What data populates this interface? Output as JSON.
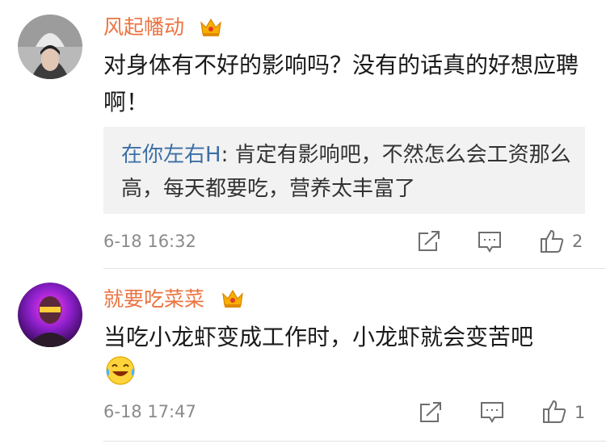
{
  "comments": [
    {
      "user": "风起幡动",
      "text": "对身体有不好的影响吗？没有的话真的好想应聘啊！",
      "reply": {
        "user": "在你左右H",
        "separator": ": ",
        "text": "肯定有影响吧，不然怎么会工资那么高，每天都要吃，营养太丰富了"
      },
      "time": "6-18 16:32",
      "likes": "2"
    },
    {
      "user": "就要吃菜菜",
      "text": "当吃小龙虾变成工作时，小龙虾就会变苦吧",
      "time": "6-18 17:47",
      "likes": "1",
      "emoji": "laughing-tears-emoji"
    }
  ],
  "icons": {
    "crown": "crown-badge-icon",
    "share": "share-icon",
    "comment": "comment-icon",
    "like": "thumbs-up-icon"
  },
  "colors": {
    "username": "#eb7340",
    "reply_user": "#3b6fa5",
    "reply_bg": "#f2f2f2",
    "timestamp": "#8a8a8a"
  }
}
